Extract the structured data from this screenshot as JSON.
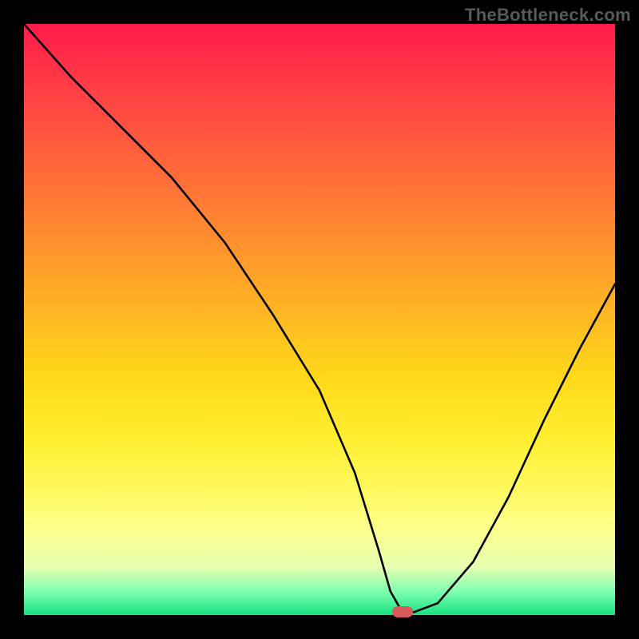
{
  "attribution": "TheBottleneck.com",
  "chart_data": {
    "type": "line",
    "title": "",
    "xlabel": "",
    "ylabel": "",
    "xlim": [
      0,
      100
    ],
    "ylim": [
      0,
      100
    ],
    "x": [
      0,
      8,
      18,
      25,
      34,
      42,
      50,
      56,
      60,
      62,
      64,
      66,
      70,
      76,
      82,
      88,
      94,
      100
    ],
    "values": [
      100,
      91,
      81,
      74,
      63,
      51,
      38,
      24,
      11,
      4,
      0.5,
      0.5,
      2,
      9,
      20,
      33,
      45,
      56
    ],
    "marker": {
      "x": 64,
      "y": 0.5
    },
    "gradient_stops": [
      {
        "pos": 0,
        "color": "#ff1a4b"
      },
      {
        "pos": 20,
        "color": "#ff5a3e"
      },
      {
        "pos": 50,
        "color": "#ffba23"
      },
      {
        "pos": 78,
        "color": "#fff85a"
      },
      {
        "pos": 96,
        "color": "#7fffb0"
      },
      {
        "pos": 100,
        "color": "#17e181"
      }
    ]
  }
}
